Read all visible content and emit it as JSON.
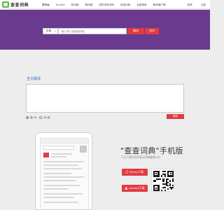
{
  "header": {
    "logo_text": "查查词典",
    "nav": [
      "繁体版",
      "English",
      "释词题",
      "繁体题",
      "简拼拼音词典",
      "成语词典",
      "百度搜索",
      "解读概产解"
    ],
    "login": "登录",
    "register": "注册"
  },
  "search": {
    "language": "中英",
    "placeholder": "输入词汇(英语或拼音)",
    "translate_label": "翻译",
    "lookup_label": "查词"
  },
  "fulltext": {
    "title": "全文翻译",
    "option_1": "英>中",
    "option_2": "汉>英",
    "button_label": "翻译"
  },
  "promo": {
    "title": "\"查查词典\"手机版",
    "subtitle": "千万人都在用的英汉词典翻译APP",
    "ios_label": "iPhone下载",
    "android_label": "Android下载"
  },
  "colors": {
    "hero": "#6a3a8e",
    "accent": "#e23b42",
    "link": "#3b6fb6"
  },
  "icons": {
    "logo": "book-logo-icon",
    "ios": "apple-icon",
    "android": "android-icon",
    "qr": "qr-code"
  }
}
